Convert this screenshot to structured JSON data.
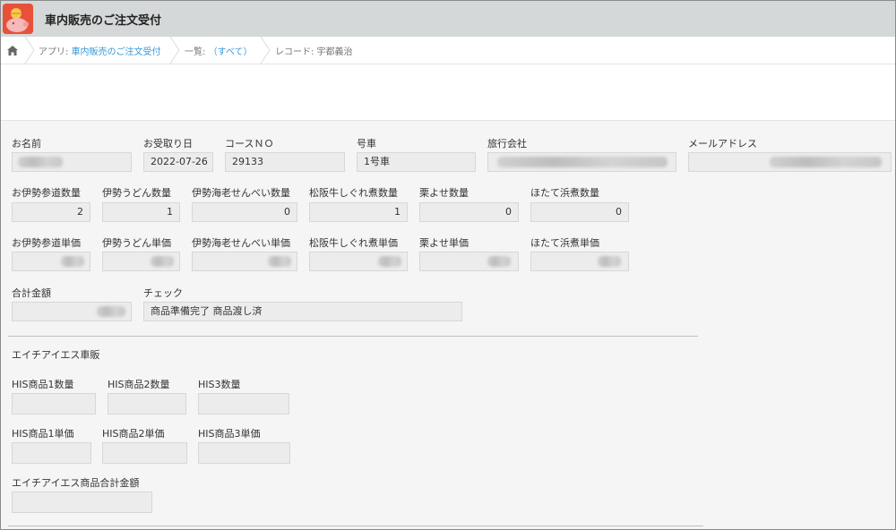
{
  "header": {
    "title": "車内販売のご注文受付"
  },
  "breadcrumb": {
    "app_prefix": "アプリ: ",
    "app_name": "車内販売のご注文受付",
    "list_prefix": "一覧: ",
    "list_name": "（すべて）",
    "record": "レコード: 宇都義治"
  },
  "row1": {
    "name_label": "お名前",
    "date_label": "お受取り日",
    "date_value": "2022-07-26",
    "course_label": "コースＮＯ",
    "course_value": "29133",
    "car_label": "号車",
    "car_value": "1号車",
    "agency_label": "旅行会社",
    "email_label": "メールアドレス"
  },
  "qty": {
    "a_label": "お伊勢参道数量",
    "a_value": "2",
    "b_label": "伊勢うどん数量",
    "b_value": "1",
    "c_label": "伊勢海老せんべい数量",
    "c_value": "0",
    "d_label": "松阪牛しぐれ煮数量",
    "d_value": "1",
    "e_label": "栗よせ数量",
    "e_value": "0",
    "f_label": "ほたて浜煮数量",
    "f_value": "0"
  },
  "price": {
    "a_label": "お伊勢参道単価",
    "b_label": "伊勢うどん単価",
    "c_label": "伊勢海老せんべい単価",
    "d_label": "松阪牛しぐれ煮単価",
    "e_label": "栗よせ単価",
    "f_label": "ほたて浜煮単価"
  },
  "total": {
    "total_label": "合計金額",
    "check_label": "チェック",
    "check_value": "商品準備完了  商品渡し済"
  },
  "his": {
    "section_title": "エイチアイエス車販",
    "q1_label": "HIS商品1数量",
    "q2_label": "HIS商品2数量",
    "q3_label": "HIS3数量",
    "p1_label": "HIS商品1単価",
    "p2_label": "HIS商品2単価",
    "p3_label": "HIS商品3単価",
    "sum_label": "エイチアイエス商品合計金額"
  }
}
